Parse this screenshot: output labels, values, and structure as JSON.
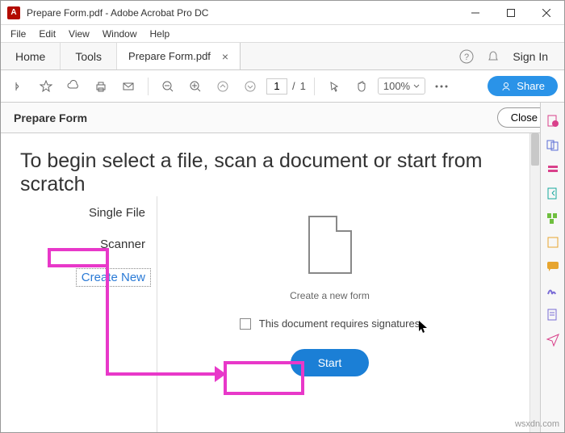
{
  "window": {
    "title": "Prepare Form.pdf - Adobe Acrobat Pro DC"
  },
  "menubar": [
    "File",
    "Edit",
    "View",
    "Window",
    "Help"
  ],
  "tabs": {
    "home": "Home",
    "tools": "Tools",
    "doc": "Prepare Form.pdf",
    "signin": "Sign In"
  },
  "toolbar": {
    "page_current": "1",
    "page_sep": "/",
    "page_total": "1",
    "zoom": "100%",
    "share": "Share"
  },
  "subbar": {
    "name": "Prepare Form",
    "close": "Close"
  },
  "main": {
    "heading": "To begin select a file, scan a document or start from scratch",
    "options": [
      "Single File",
      "Scanner",
      "Create New"
    ],
    "caption": "Create a new form",
    "requires_sig": "This document requires signatures",
    "start": "Start"
  },
  "watermark": "wsxdn.com"
}
